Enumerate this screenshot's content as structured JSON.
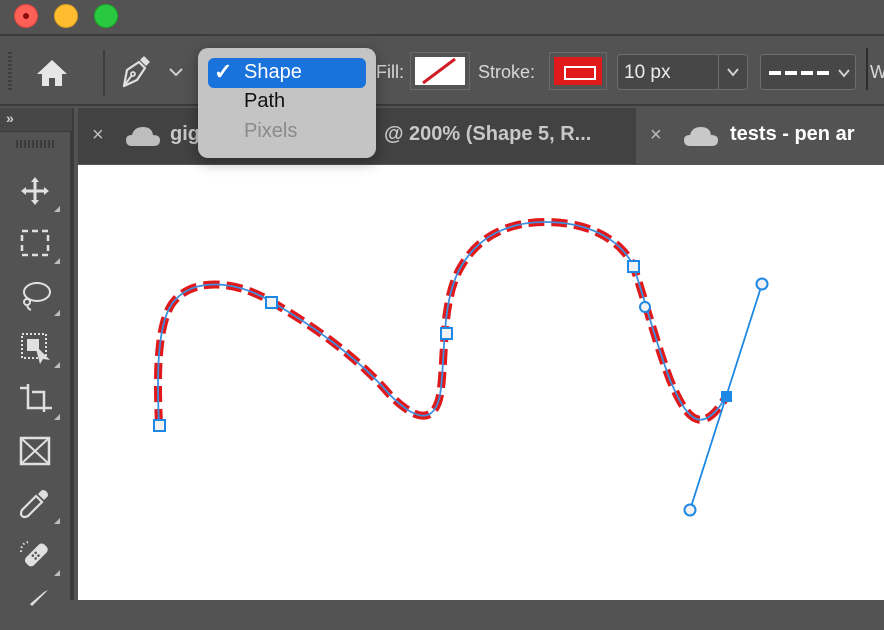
{
  "window": {
    "traffic_lights": [
      "close",
      "minimize",
      "maximize"
    ]
  },
  "options_bar": {
    "home_icon": "home-icon",
    "tool_icon": "pen-tool-icon",
    "fill_label": "Fill:",
    "fill_value": "none",
    "stroke_label": "Stroke:",
    "stroke_color": "#e0191b",
    "stroke_width": "10 px",
    "stroke_style": "dashed",
    "w_label": "W"
  },
  "mode_dropdown": {
    "options": [
      {
        "label": "Shape",
        "selected": true,
        "enabled": true
      },
      {
        "label": "Path",
        "selected": false,
        "enabled": true
      },
      {
        "label": "Pixels",
        "selected": false,
        "enabled": false
      }
    ],
    "check": "✓"
  },
  "toolbar": {
    "expand": "»",
    "tools": [
      {
        "name": "move-tool"
      },
      {
        "name": "rectangular-marquee-tool"
      },
      {
        "name": "lasso-tool"
      },
      {
        "name": "object-selection-tool"
      },
      {
        "name": "crop-tool"
      },
      {
        "name": "frame-tool"
      },
      {
        "name": "eyedropper-tool"
      },
      {
        "name": "spot-healing-brush-tool"
      }
    ]
  },
  "tabs": [
    {
      "title_left": "gig",
      "title_right": "@ 200% (Shape 5, R...",
      "active": false,
      "close": "×"
    },
    {
      "title": "tests - pen ar",
      "active": true,
      "close": "×"
    }
  ],
  "colors": {
    "accent": "#1a72dc",
    "path_blue": "#1e88e5",
    "stroke_red": "#e0191b"
  }
}
